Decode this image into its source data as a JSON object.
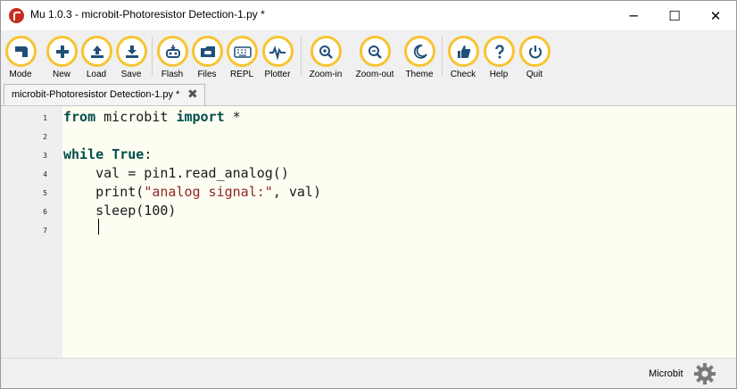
{
  "window": {
    "title": "Mu 1.0.3 - microbit-Photoresistor Detection-1.py *",
    "minimize_glyph": "─",
    "maximize_glyph": "☐",
    "close_glyph": "✕"
  },
  "toolbar": {
    "accent_color": "#f7c431",
    "buttons": [
      {
        "label": "Mode",
        "icon": "mode-icon"
      },
      {
        "label": "New",
        "icon": "plus-icon"
      },
      {
        "label": "Load",
        "icon": "upload-icon"
      },
      {
        "label": "Save",
        "icon": "download-icon"
      },
      {
        "label": "Flash",
        "icon": "flash-icon"
      },
      {
        "label": "Files",
        "icon": "files-icon"
      },
      {
        "label": "REPL",
        "icon": "keyboard-icon"
      },
      {
        "label": "Plotter",
        "icon": "pulse-icon"
      },
      {
        "label": "Zoom-in",
        "icon": "zoom-in-icon"
      },
      {
        "label": "Zoom-out",
        "icon": "zoom-out-icon"
      },
      {
        "label": "Theme",
        "icon": "moon-icon"
      },
      {
        "label": "Check",
        "icon": "thumbs-up-icon"
      },
      {
        "label": "Help",
        "icon": "question-icon"
      },
      {
        "label": "Quit",
        "icon": "power-icon"
      }
    ]
  },
  "tabs": [
    {
      "label": "microbit-Photoresistor Detection-1.py *",
      "close_glyph": "✖"
    }
  ],
  "editor": {
    "line_numbers": [
      "1",
      "2",
      "3",
      "4",
      "5",
      "6",
      "7"
    ],
    "lines": [
      {
        "tokens": [
          {
            "t": "from",
            "k": "kw"
          },
          {
            "t": " microbit ",
            "k": "plain"
          },
          {
            "t": "import",
            "k": "kw"
          },
          {
            "t": " *",
            "k": "plain"
          }
        ]
      },
      {
        "tokens": []
      },
      {
        "tokens": [
          {
            "t": "while",
            "k": "kw"
          },
          {
            "t": " ",
            "k": "plain"
          },
          {
            "t": "True",
            "k": "kw"
          },
          {
            "t": ":",
            "k": "plain"
          }
        ]
      },
      {
        "tokens": [
          {
            "t": "    val = pin1.read_analog()",
            "k": "plain"
          }
        ]
      },
      {
        "tokens": [
          {
            "t": "    print(",
            "k": "plain"
          },
          {
            "t": "\"analog signal:\"",
            "k": "str"
          },
          {
            "t": ", val)",
            "k": "plain"
          }
        ]
      },
      {
        "tokens": [
          {
            "t": "    sleep(100)",
            "k": "plain"
          }
        ]
      },
      {
        "tokens": [
          {
            "t": "    ",
            "k": "plain"
          }
        ]
      }
    ]
  },
  "status": {
    "mode": "Microbit",
    "settings_icon": "gear-icon"
  }
}
